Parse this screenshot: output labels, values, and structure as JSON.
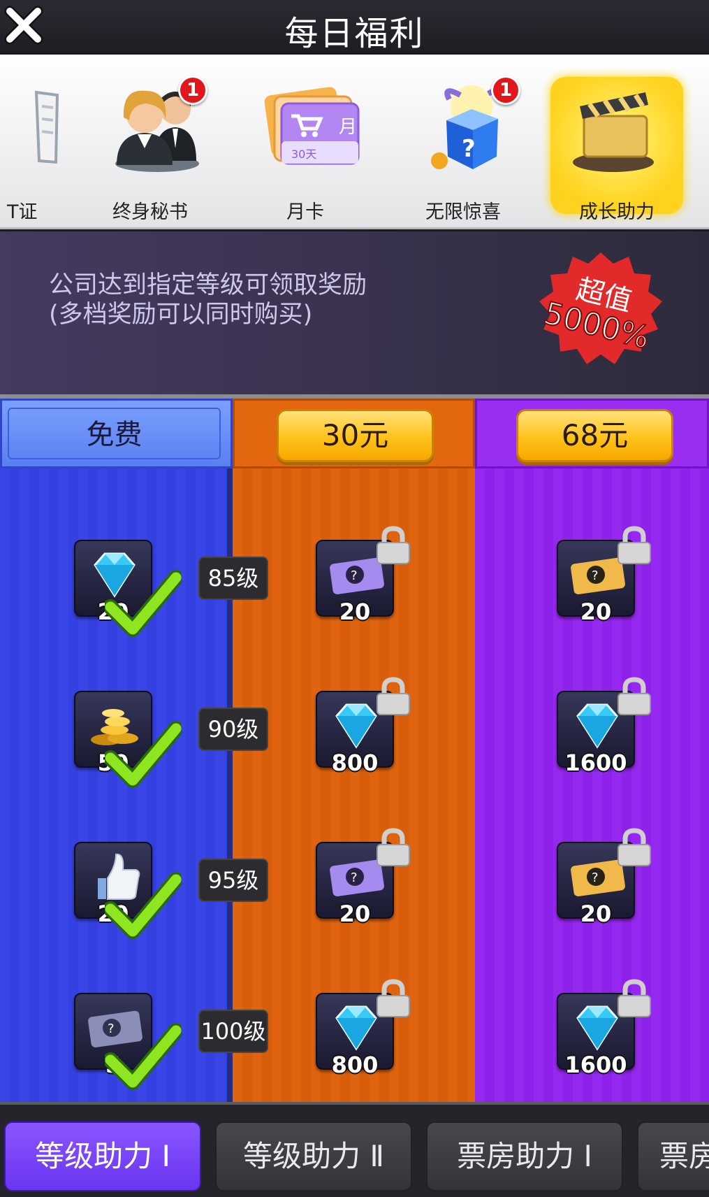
{
  "header": {
    "title": "每日福利"
  },
  "strip": {
    "items": [
      {
        "label": "T证",
        "badge": ""
      },
      {
        "label": "终身秘书",
        "badge": "1"
      },
      {
        "label": "月卡",
        "badge": ""
      },
      {
        "label": "无限惊喜",
        "badge": "1"
      },
      {
        "label": "成长助力",
        "badge": "",
        "active": true
      }
    ],
    "month_card": {
      "tag": "月",
      "days": "30天"
    }
  },
  "banner": {
    "line1": "公司达到指定等级可领取奖励",
    "line2": "(多档奖励可以同时购买)",
    "seal_top": "超值",
    "seal_bottom": "5000%"
  },
  "columns": {
    "free": {
      "label": "免费"
    },
    "tier30": {
      "label": "30元"
    },
    "tier68": {
      "label": "68元"
    }
  },
  "rows": [
    {
      "level": "85级",
      "free": {
        "icon": "diamond-icon",
        "qty": "20",
        "claimed": true
      },
      "tier30": {
        "icon": "purple-card-icon",
        "qty": "20",
        "locked": true
      },
      "tier68": {
        "icon": "gold-card-icon",
        "qty": "20",
        "locked": true
      }
    },
    {
      "level": "90级",
      "free": {
        "icon": "gold-coins-icon",
        "qty": "50",
        "claimed": true
      },
      "tier30": {
        "icon": "diamond-icon",
        "qty": "800",
        "locked": true
      },
      "tier68": {
        "icon": "diamond-icon",
        "qty": "1600",
        "locked": true
      }
    },
    {
      "level": "95级",
      "free": {
        "icon": "thumbs-up-icon",
        "qty": "20",
        "claimed": true
      },
      "tier30": {
        "icon": "purple-card-icon",
        "qty": "20",
        "locked": true
      },
      "tier68": {
        "icon": "gold-card-icon",
        "qty": "20",
        "locked": true
      }
    },
    {
      "level": "100级",
      "free": {
        "icon": "grey-card-icon",
        "qty": "5",
        "claimed": true
      },
      "tier30": {
        "icon": "diamond-icon",
        "qty": "800",
        "locked": true
      },
      "tier68": {
        "icon": "diamond-icon",
        "qty": "1600",
        "locked": true
      }
    }
  ],
  "tabs": [
    {
      "label": "等级助力 Ⅰ",
      "active": true
    },
    {
      "label": "等级助力 Ⅱ",
      "active": false
    },
    {
      "label": "票房助力 Ⅰ",
      "active": false
    },
    {
      "label": "票房",
      "active": false
    }
  ],
  "colors": {
    "free": "#3a45e8",
    "tier30": "#e06410",
    "tier68": "#9629ef",
    "active_tab": "#7a45f8"
  }
}
